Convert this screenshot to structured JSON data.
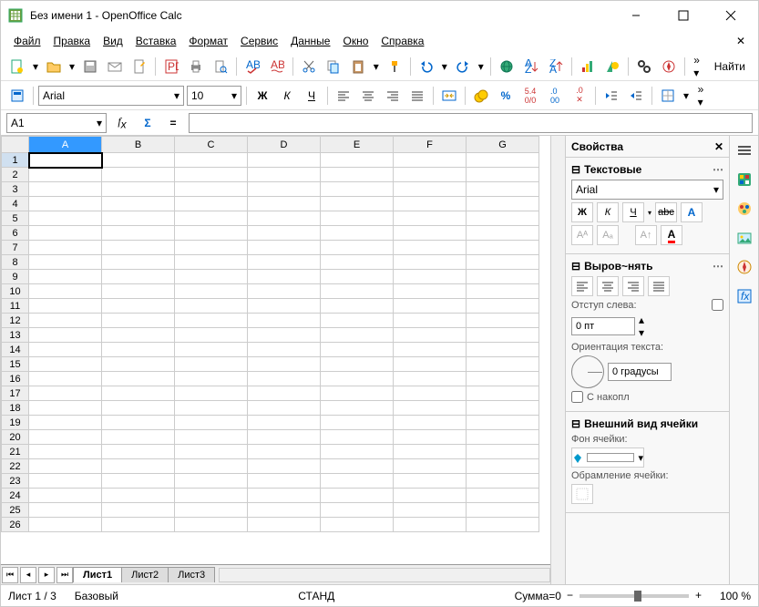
{
  "title": "Без имени 1 - OpenOffice Calc",
  "menu": [
    "Файл",
    "Правка",
    "Вид",
    "Вставка",
    "Формат",
    "Сервис",
    "Данные",
    "Окно",
    "Справка"
  ],
  "find_label": "Найти",
  "font_name": "Arial",
  "font_size": "10",
  "cell_ref": "A1",
  "columns": [
    "A",
    "B",
    "C",
    "D",
    "E",
    "F",
    "G"
  ],
  "rows": [
    "1",
    "2",
    "3",
    "4",
    "5",
    "6",
    "7",
    "8",
    "9",
    "10",
    "11",
    "12",
    "13",
    "14",
    "15",
    "16",
    "17",
    "18",
    "19",
    "20",
    "21",
    "22",
    "23",
    "24",
    "25",
    "26"
  ],
  "sheet_tabs": [
    "Лист1",
    "Лист2",
    "Лист3"
  ],
  "active_sheet": 0,
  "sidepanel": {
    "title": "Свойства",
    "text_section": "Текстовые",
    "font": "Arial",
    "align_section": "Выров~нять",
    "indent_label": "Отступ слева:",
    "indent_value": "0 пт",
    "orientation_label": "Ориентация текста:",
    "orientation_value": "0 градусы",
    "stack_label": "С накопл",
    "cell_section": "Внешний вид ячейки",
    "bg_label": "Фон ячейки:",
    "border_label": "Обрамление ячейки:"
  },
  "status": {
    "sheet": "Лист 1 / 3",
    "style": "Базовый",
    "mode": "СТАНД",
    "sum": "Сумма=0",
    "zoom": "100 %"
  }
}
